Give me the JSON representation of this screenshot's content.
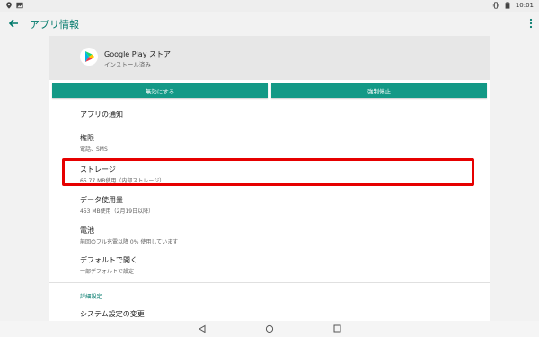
{
  "status_bar": {
    "time": "10:01"
  },
  "app_bar": {
    "title": "アプリ情報"
  },
  "app": {
    "name": "Google Play ストア",
    "status": "インストール済み"
  },
  "buttons": {
    "disable": "無効にする",
    "force_stop": "強制停止"
  },
  "items": [
    {
      "title": "アプリの通知",
      "subtitle": ""
    },
    {
      "title": "権限",
      "subtitle": "電話、SMS"
    },
    {
      "title": "ストレージ",
      "subtitle": "65.77 MB使用（内部ストレージ）"
    },
    {
      "title": "データ使用量",
      "subtitle": "453 MB使用（2月19日以降）"
    },
    {
      "title": "電池",
      "subtitle": "前回のフル充電以降 0% 使用しています"
    },
    {
      "title": "デフォルトで開く",
      "subtitle": "一部デフォルトで設定"
    }
  ],
  "section": {
    "label": "詳細設定"
  },
  "last_item": {
    "title": "システム設定の変更"
  },
  "colors": {
    "accent": "#139986",
    "highlight": "#e60000",
    "title_teal": "#00796b"
  },
  "icons": [
    "location-icon",
    "image-icon",
    "vibrate-icon",
    "battery-icon",
    "back-arrow-icon",
    "more-vert-icon",
    "google-play-icon",
    "nav-back-icon",
    "nav-home-icon",
    "nav-recents-icon"
  ]
}
